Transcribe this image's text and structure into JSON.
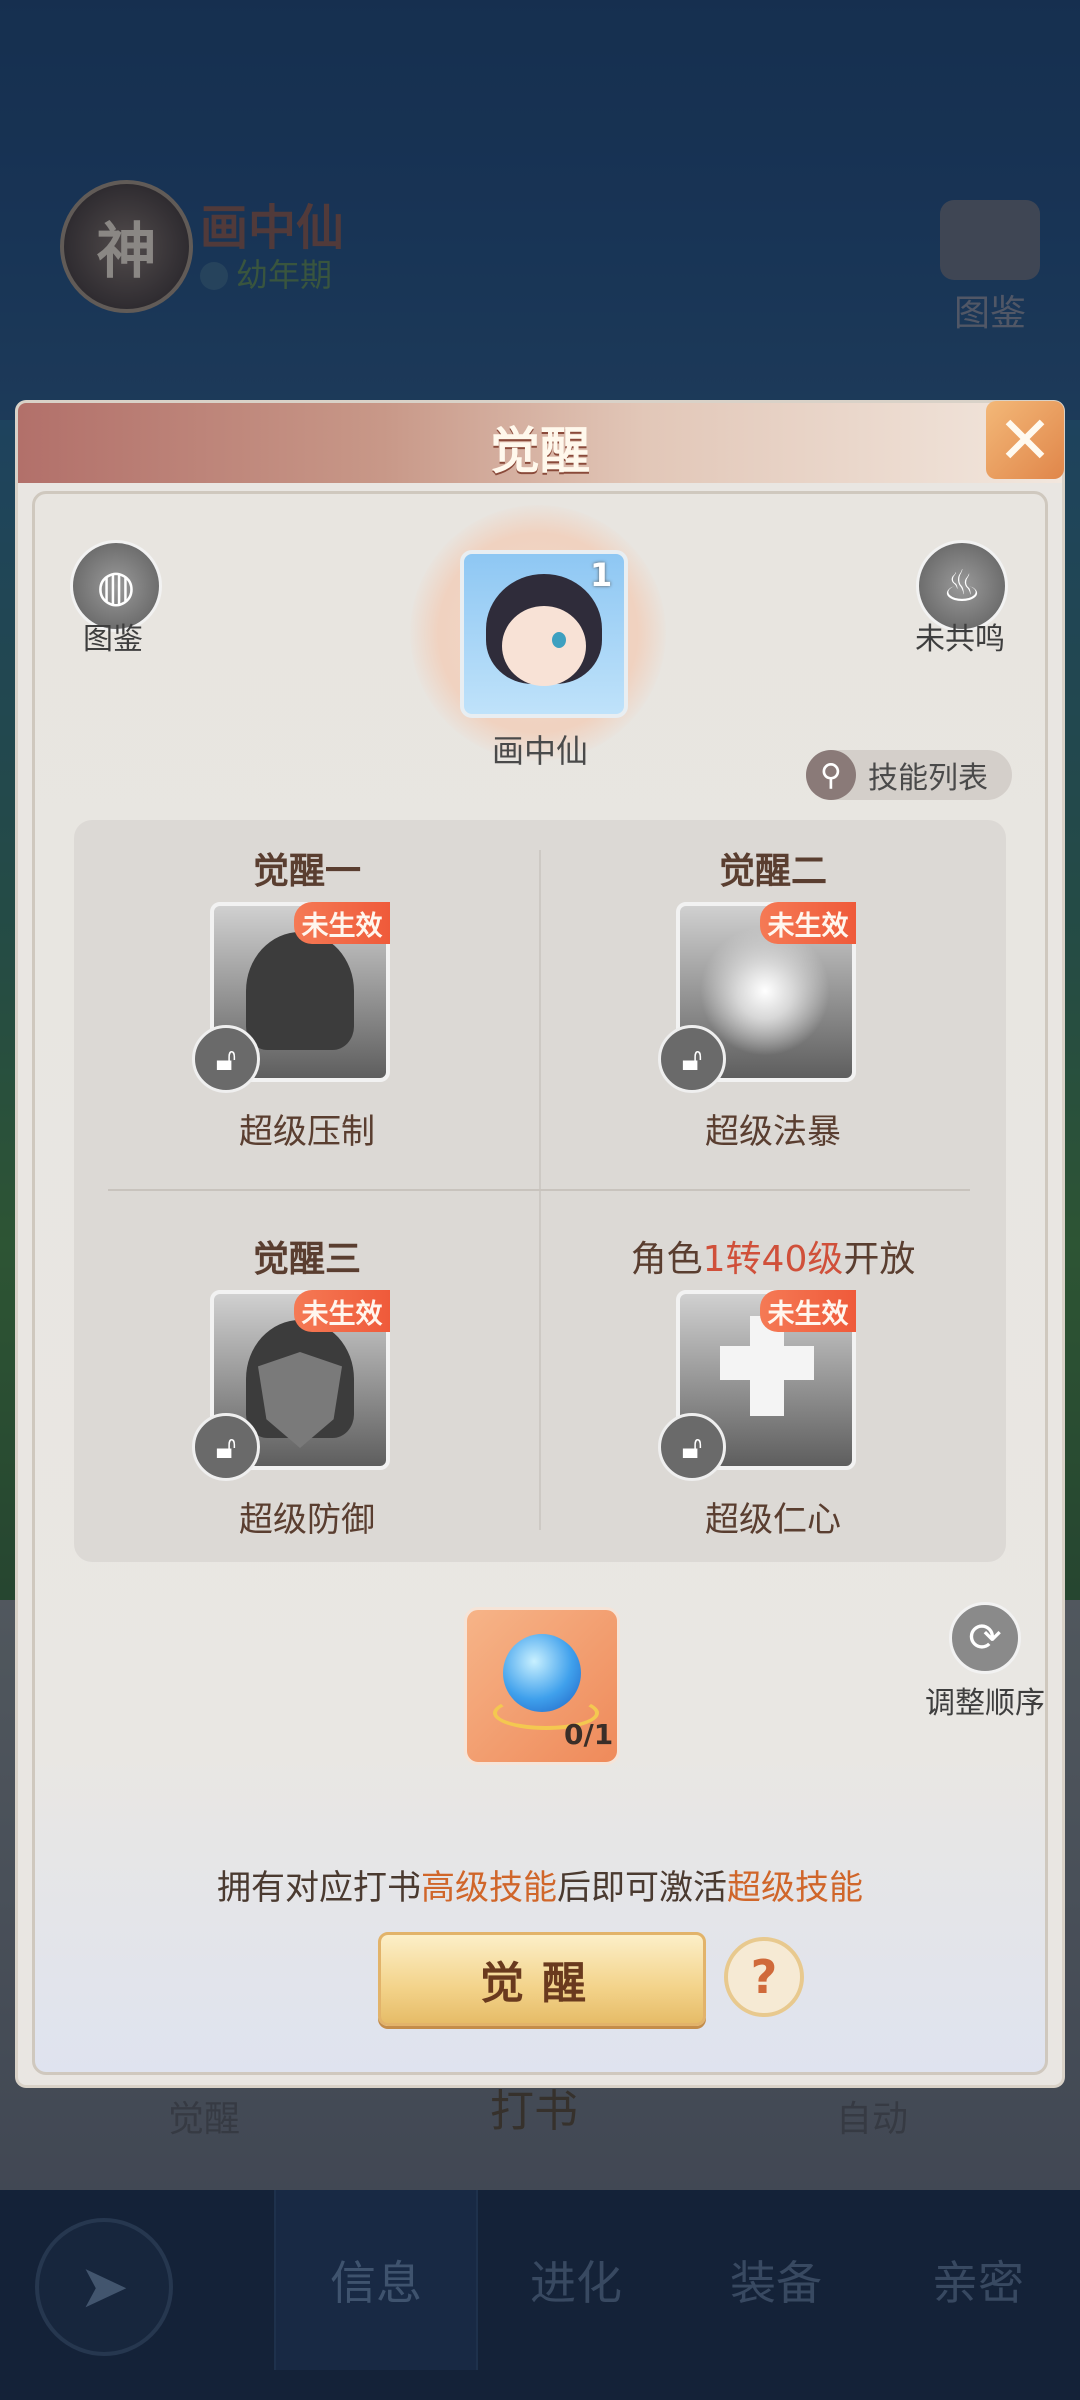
{
  "background": {
    "god_badge": "神",
    "pet_name": "画中仙",
    "pet_stage": "幼年期",
    "atlas_label": "图鉴",
    "awaken_label": "觉醒",
    "write_book_label": "打书",
    "auto_label": "自动",
    "nav": {
      "back_icon": "compass-icon",
      "tabs": [
        "信息",
        "进化",
        "装备",
        "亲密"
      ]
    }
  },
  "modal": {
    "title": "觉醒",
    "close": "✕",
    "atlas_label": "图鉴",
    "resonance_label": "未共鸣",
    "avatar_star": "1",
    "char_name": "画中仙",
    "skill_list_label": "技能列表",
    "cells": [
      {
        "title": "觉醒一",
        "badge": "未生效",
        "skill": "超级压制"
      },
      {
        "title": "觉醒二",
        "badge": "未生效",
        "skill": "超级法暴"
      },
      {
        "title": "觉醒三",
        "badge": "未生效",
        "skill": "超级防御"
      },
      {
        "title_pre": "角色",
        "title_hl": "1转40级",
        "title_post": "开放",
        "badge": "未生效",
        "skill": "超级仁心"
      }
    ],
    "stone_count": "0/1",
    "reorder_label": "调整顺序",
    "hint": {
      "p1": "拥有对应打书",
      "hl1": "高级技能",
      "p2": "后即可激活",
      "hl2": "超级技能"
    },
    "awaken_button": "觉醒",
    "help": "?"
  },
  "colors": {
    "accent": "#d0503a",
    "hint_highlight": "#d0662a",
    "badge": "#ef5a3a"
  }
}
